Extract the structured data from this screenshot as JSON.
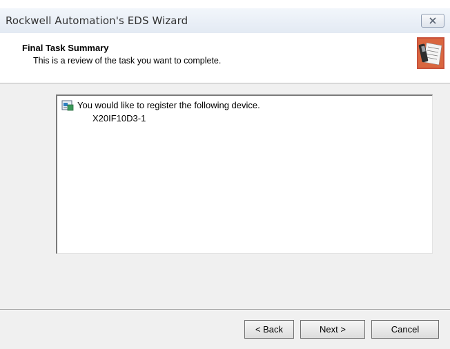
{
  "window": {
    "title": "Rockwell Automation's EDS Wizard",
    "close_icon": "close-icon"
  },
  "header": {
    "title": "Final Task Summary",
    "subtitle": "This is a review of the task you want to complete.",
    "icon": "wizard-document-icon"
  },
  "summary": {
    "icon": "device-icon",
    "line1": "You would like to register the following device.",
    "line2": "X20IF10D3-1"
  },
  "buttons": {
    "back": "< Back",
    "next": "Next >",
    "cancel": "Cancel"
  }
}
